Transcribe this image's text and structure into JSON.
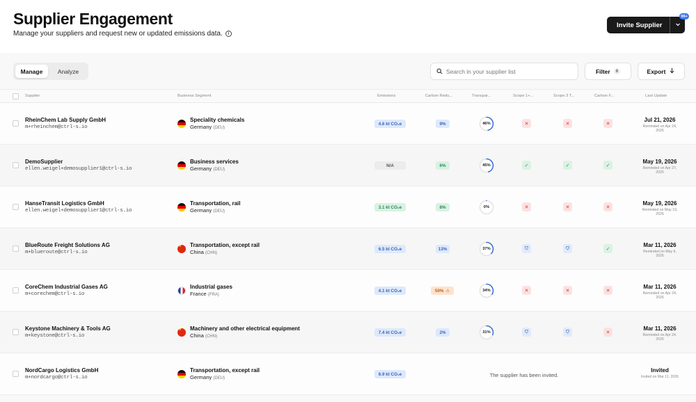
{
  "header": {
    "title": "Supplier Engagement",
    "subtitle": "Manage your suppliers and request new or updated emissions data.",
    "info_icon": "i",
    "invite_label": "Invite Supplier",
    "invite_menu_icon": "chevron-down-icon",
    "notification_count": "99+"
  },
  "tabs": [
    {
      "label": "Manage",
      "active": true
    },
    {
      "label": "Analyze",
      "active": false
    }
  ],
  "toolbar": {
    "search_placeholder": "Search in your supplier list",
    "filter_label": "Filter",
    "filter_count": "0",
    "export_label": "Export"
  },
  "columns": [
    "Supplier",
    "Business Segment",
    "Emissions",
    "Carbon Redu...",
    "Transpar...",
    "Scope 1+...",
    "Scope 3 T...",
    "Carbon F...",
    "Last Update"
  ],
  "rows": [
    {
      "name": "RheinChem Lab Supply GmbH",
      "email": "m+rheinchem@ctrl-s.io",
      "segment": "Speciality chemicals",
      "country": "Germany",
      "code": "(DEU)",
      "flag": "de",
      "emissions": "4.6 kt CO₂e",
      "emissions_style": "blue",
      "reduction": "9%",
      "reduction_style": "blue",
      "reduction_warning": "",
      "transparency": "46%",
      "transparency_value": 46,
      "scope12": "x",
      "scope3": "x",
      "carbon": "x",
      "last_update": "Jul 21, 2026",
      "note": "Reminded on Apr 24, 2026",
      "invited_message": ""
    },
    {
      "name": "DemoSupplier",
      "email": "ellen.weigel+demosupplier1@ctrl-s.io",
      "segment": "Business services",
      "country": "Germany",
      "code": "(DEU)",
      "flag": "de",
      "emissions": "N/A",
      "emissions_style": "gray",
      "reduction": "6%",
      "reduction_style": "green",
      "reduction_warning": "",
      "transparency": "45%",
      "transparency_value": 45,
      "scope12": "ok",
      "scope3": "ok",
      "carbon": "ok",
      "last_update": "May 19, 2026",
      "note": "Reminded on Apr 27, 2026",
      "invited_message": ""
    },
    {
      "name": "HanseTransit Logistics GmbH",
      "email": "ellen.weigel+demosupplier1@ctrl-s.io",
      "segment": "Transportation, rail",
      "country": "Germany",
      "code": "(DEU)",
      "flag": "de",
      "emissions": "3.1 kt CO₂e",
      "emissions_style": "green",
      "reduction": "8%",
      "reduction_style": "green",
      "reduction_warning": "",
      "transparency": "0%",
      "transparency_value": 0,
      "scope12": "x",
      "scope3": "x",
      "carbon": "x",
      "last_update": "May 19, 2026",
      "note": "Reminded on May 19, 2026",
      "invited_message": ""
    },
    {
      "name": "BlueRoute Freight Solutions AG",
      "email": "m+blueroute@ctrl-s.io",
      "segment": "Transportation, except rail",
      "country": "China",
      "code": "(CHN)",
      "flag": "cn",
      "emissions": "6.5 kt CO₂e",
      "emissions_style": "blue",
      "reduction": "13%",
      "reduction_style": "blue",
      "reduction_warning": "",
      "transparency": "37%",
      "transparency_value": 37,
      "scope12": "sh",
      "scope3": "sh",
      "carbon": "ok",
      "last_update": "Mar 11, 2026",
      "note": "Reminded on May 6, 2026",
      "invited_message": ""
    },
    {
      "name": "CoreChem Industrial Gases AG",
      "email": "m+corechem@ctrl-s.io",
      "segment": "Industrial gases",
      "country": "France",
      "code": "(FRA)",
      "flag": "fr",
      "emissions": "4.1 kt CO₂e",
      "emissions_style": "blue",
      "reduction": "59%",
      "reduction_style": "orange",
      "reduction_warning": "⚠",
      "transparency": "34%",
      "transparency_value": 34,
      "scope12": "x",
      "scope3": "x",
      "carbon": "x",
      "last_update": "Mar 11, 2026",
      "note": "Reminded on Apr 24, 2026",
      "invited_message": ""
    },
    {
      "name": "Keystone Machinery & Tools AG",
      "email": "m+keystone@ctrl-s.io",
      "segment": "Machinery and other electrical equipment",
      "country": "China",
      "code": "(CHN)",
      "flag": "cn",
      "emissions": "7.4 kt CO₂e",
      "emissions_style": "blue",
      "reduction": "2%",
      "reduction_style": "blue",
      "reduction_warning": "",
      "transparency": "31%",
      "transparency_value": 31,
      "scope12": "sh",
      "scope3": "sh",
      "carbon": "x",
      "last_update": "Mar 11, 2026",
      "note": "Reminded on Apr 24, 2026",
      "invited_message": ""
    },
    {
      "name": "NordCargo Logistics GmbH",
      "email": "m+nordcargo@ctrl-s.io",
      "segment": "Transportation, except rail",
      "country": "Germany",
      "code": "(DEU)",
      "flag": "de",
      "emissions": "6.9 kt CO₂e",
      "emissions_style": "blue",
      "reduction": "",
      "reduction_style": "",
      "reduction_warning": "",
      "transparency": "",
      "transparency_value": null,
      "scope12": "",
      "scope3": "",
      "carbon": "",
      "last_update": "Invited",
      "note": "Invited on Mar 11, 2026",
      "invited_message": "The supplier has been invited."
    }
  ],
  "colors": {
    "accent": "#3a78f2",
    "ring": "#3b6fd6",
    "button_dark": "#1a1a1a"
  }
}
